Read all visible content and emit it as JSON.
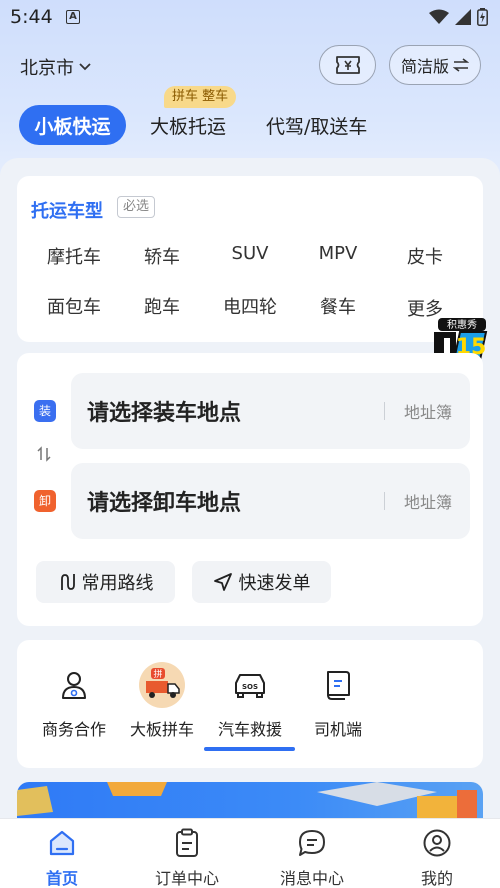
{
  "status_bar": {
    "time": "5:44",
    "notification_letter": "A"
  },
  "header": {
    "city": "北京市",
    "simple_version_label": "简洁版"
  },
  "tabs": [
    {
      "label": "小板快运",
      "active": true
    },
    {
      "label": "大板托运",
      "active": false
    },
    {
      "label": "代驾/取送车",
      "active": false
    }
  ],
  "tab_badge": "拼车 整车",
  "vehicle": {
    "title": "托运车型",
    "required": "必选",
    "types": [
      "摩托车",
      "轿车",
      "SUV",
      "MPV",
      "皮卡",
      "面包车",
      "跑车",
      "电四轮",
      "餐车",
      "更多"
    ]
  },
  "promo_text": "积惠秀",
  "address": {
    "load_badge": "装",
    "unload_badge": "卸",
    "load_placeholder": "请选择装车地点",
    "unload_placeholder": "请选择卸车地点",
    "address_book": "地址簿"
  },
  "quick_actions": [
    {
      "label": "常用路线",
      "icon": "route-icon"
    },
    {
      "label": "快速发单",
      "icon": "send-icon"
    }
  ],
  "services": [
    {
      "label": "商务合作",
      "icon": "business-icon"
    },
    {
      "label": "大板拼车",
      "icon": "carpool-truck-icon"
    },
    {
      "label": "汽车救援",
      "icon": "sos-car-icon"
    },
    {
      "label": "司机端",
      "icon": "driver-icon"
    }
  ],
  "bottom_nav": [
    {
      "label": "首页",
      "icon": "home-icon",
      "active": true
    },
    {
      "label": "订单中心",
      "icon": "order-icon",
      "active": false
    },
    {
      "label": "消息中心",
      "icon": "message-icon",
      "active": false
    },
    {
      "label": "我的",
      "icon": "profile-icon",
      "active": false
    }
  ],
  "colors": {
    "accent": "#2f6ff2",
    "load_badge": "#3a6ff0",
    "unload_badge": "#f0622e"
  }
}
